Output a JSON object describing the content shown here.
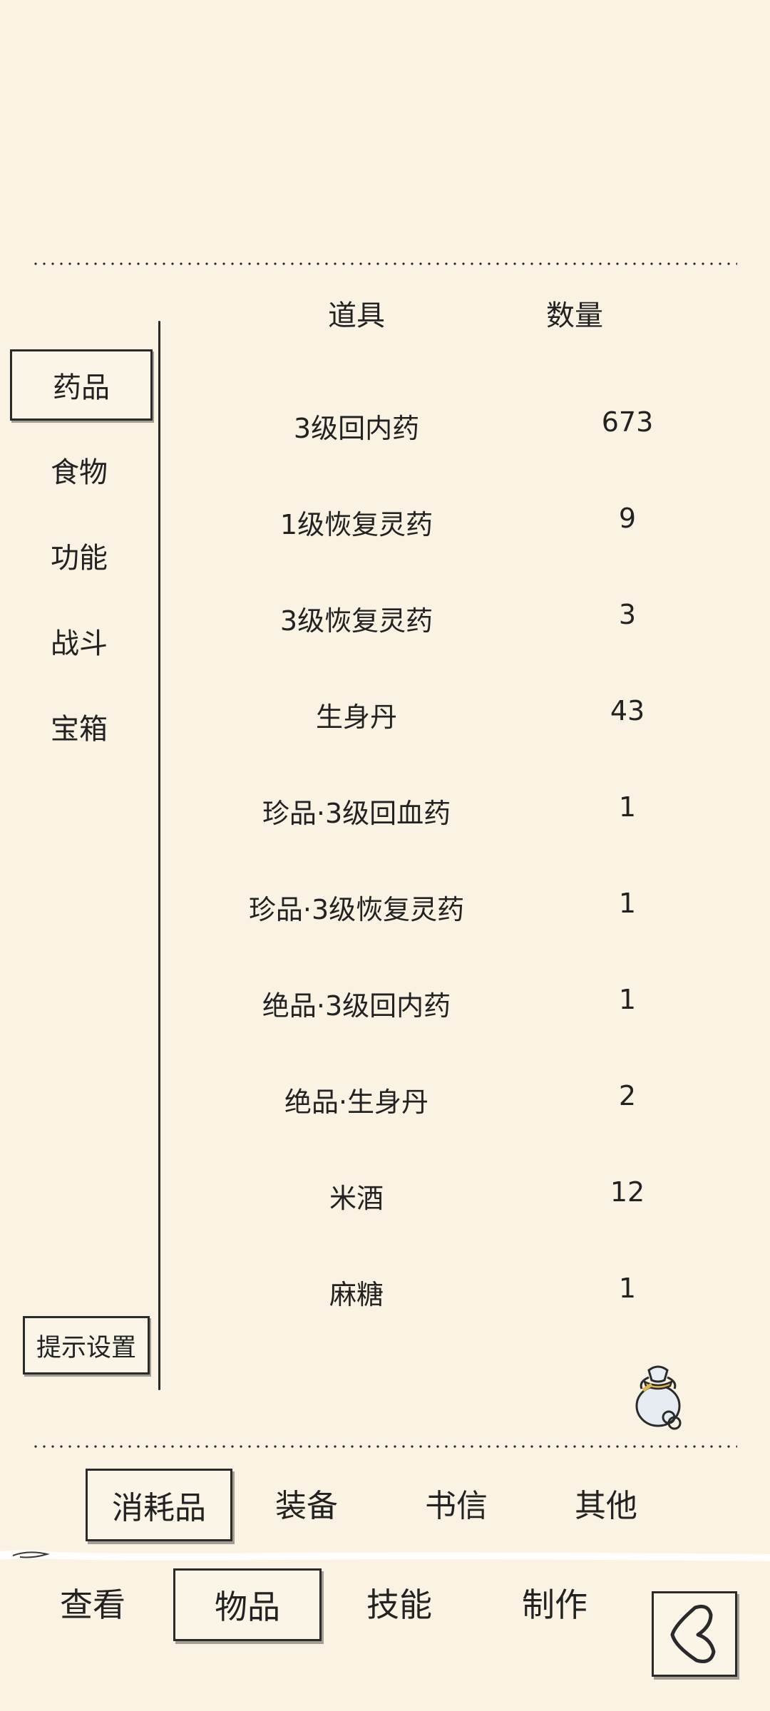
{
  "sidebar": {
    "items": [
      {
        "label": "药品",
        "active": true
      },
      {
        "label": "食物",
        "active": false
      },
      {
        "label": "功能",
        "active": false
      },
      {
        "label": "战斗",
        "active": false
      },
      {
        "label": "宝箱",
        "active": false
      }
    ],
    "hint_button": "提示设置"
  },
  "table": {
    "headers": {
      "item": "道具",
      "quantity": "数量"
    },
    "rows": [
      {
        "name": "3级回内药",
        "qty": "673"
      },
      {
        "name": "1级恢复灵药",
        "qty": "9"
      },
      {
        "name": "3级恢复灵药",
        "qty": "3"
      },
      {
        "name": "生身丹",
        "qty": "43"
      },
      {
        "name": "珍品·3级回血药",
        "qty": "1"
      },
      {
        "name": "珍品·3级恢复灵药",
        "qty": "1"
      },
      {
        "name": "绝品·3级回内药",
        "qty": "1"
      },
      {
        "name": "绝品·生身丹",
        "qty": "2"
      },
      {
        "name": "米酒",
        "qty": "12"
      },
      {
        "name": "麻糖",
        "qty": "1"
      }
    ]
  },
  "category_tabs": [
    {
      "label": "消耗品",
      "active": true
    },
    {
      "label": "装备",
      "active": false
    },
    {
      "label": "书信",
      "active": false
    },
    {
      "label": "其他",
      "active": false
    }
  ],
  "bottom_nav": [
    {
      "label": "查看",
      "active": false
    },
    {
      "label": "物品",
      "active": true
    },
    {
      "label": "技能",
      "active": false
    },
    {
      "label": "制作",
      "active": false
    }
  ],
  "icons": {
    "bag": "money-bag-icon",
    "back": "back-arrow-icon"
  },
  "colors": {
    "background": "#faf3e3",
    "ink": "#2a2a2a"
  }
}
